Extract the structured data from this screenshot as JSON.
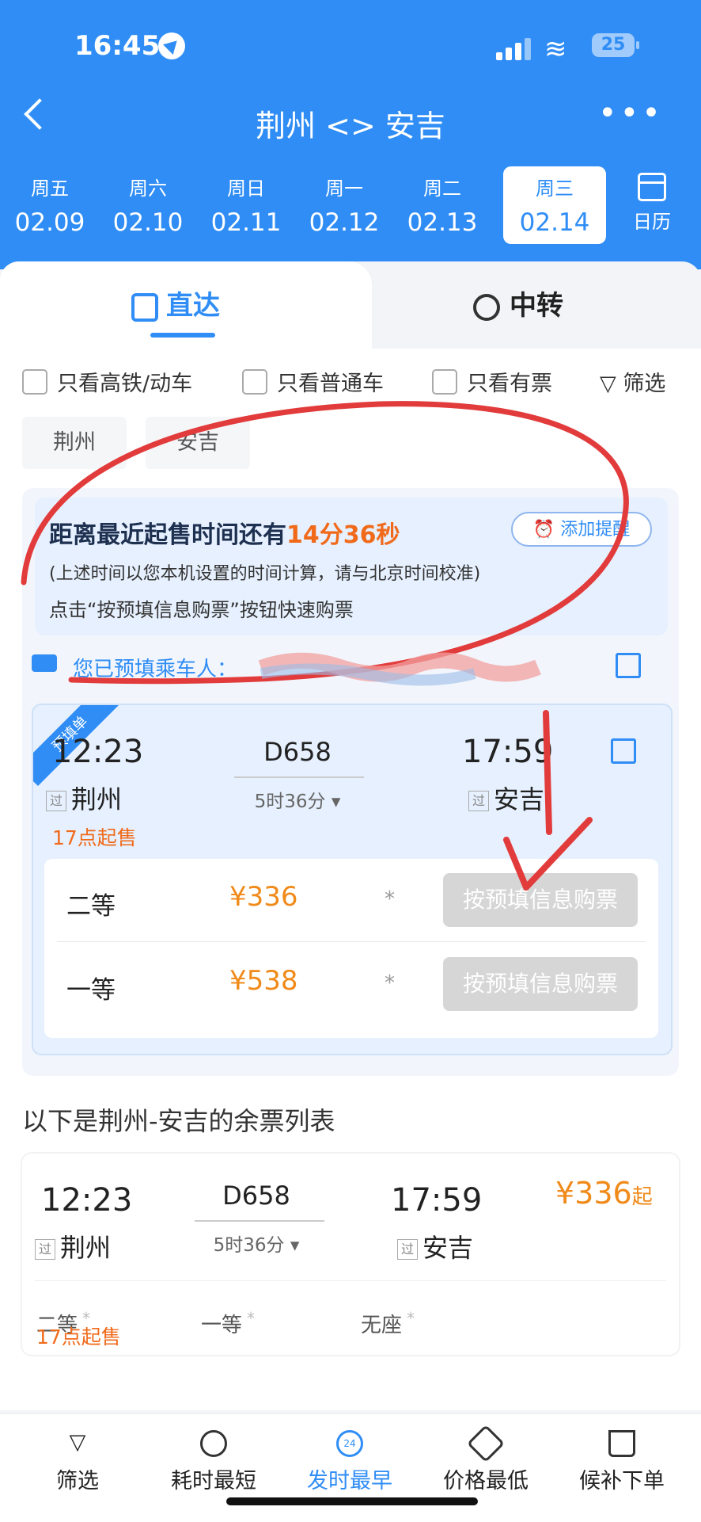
{
  "status": {
    "time": "16:45",
    "battery": "25"
  },
  "nav": {
    "title": "荆州 <> 安吉",
    "more": "•••"
  },
  "dates": [
    {
      "weekday": "周五",
      "date": "02.09"
    },
    {
      "weekday": "周六",
      "date": "02.10"
    },
    {
      "weekday": "周日",
      "date": "02.11"
    },
    {
      "weekday": "周一",
      "date": "02.12"
    },
    {
      "weekday": "周二",
      "date": "02.13"
    },
    {
      "weekday": "周三",
      "date": "02.14"
    }
  ],
  "calendar_label": "日历",
  "tabs": {
    "direct": "直达",
    "transfer": "中转"
  },
  "filters": {
    "hsr": "只看高铁/动车",
    "normal": "只看普通车",
    "available": "只看有票",
    "filter": "筛选"
  },
  "chips": {
    "from": "荆州",
    "to": "安吉"
  },
  "notice": {
    "title_prefix": "距离最近起售时间还有",
    "countdown": "14分36秒",
    "remind": "添加提醒",
    "sub": "(上述时间以您本机设置的时间计算，请与北京时间校准)",
    "sub2": "点击“按预填信息购票”按钮快速购票"
  },
  "passenger": {
    "label": "您已预填乘车人："
  },
  "prefilled": {
    "ribbon": "预填单",
    "depart_time": "12:23",
    "arrive_time": "17:59",
    "train": "D658",
    "duration": "5时36分",
    "from": "荆州",
    "to": "安吉",
    "pass_tag": "过",
    "sale": "17点起售",
    "seats": [
      {
        "name": "二等",
        "price": "¥336",
        "avail": "*",
        "button": "按预填信息购票"
      },
      {
        "name": "一等",
        "price": "¥538",
        "avail": "*",
        "button": "按预填信息购票"
      }
    ]
  },
  "list_title": "以下是荆州-安吉的余票列表",
  "list_item": {
    "depart_time": "12:23",
    "arrive_time": "17:59",
    "train": "D658",
    "duration": "5时36分",
    "from": "荆州",
    "to": "安吉",
    "pass_tag": "过",
    "price": "¥336",
    "price_suffix": "起",
    "seats": [
      {
        "name": "二等",
        "avail": "*"
      },
      {
        "name": "一等",
        "avail": "*"
      },
      {
        "name": "无座",
        "avail": "*"
      }
    ],
    "sale": "17点起售"
  },
  "bottom": [
    {
      "label": "筛选",
      "icon": "funnel-icon"
    },
    {
      "label": "耗时最短",
      "icon": "clock-icon"
    },
    {
      "label": "发时最早",
      "icon": "24h-icon",
      "badge": "24"
    },
    {
      "label": "价格最低",
      "icon": "price-tag-icon"
    },
    {
      "label": "候补下单",
      "icon": "cart-icon"
    }
  ],
  "colors": {
    "primary": "#2f8df5",
    "orange": "#f06a1a",
    "price": "#f08a1a",
    "annotation": "#e23b3b"
  }
}
